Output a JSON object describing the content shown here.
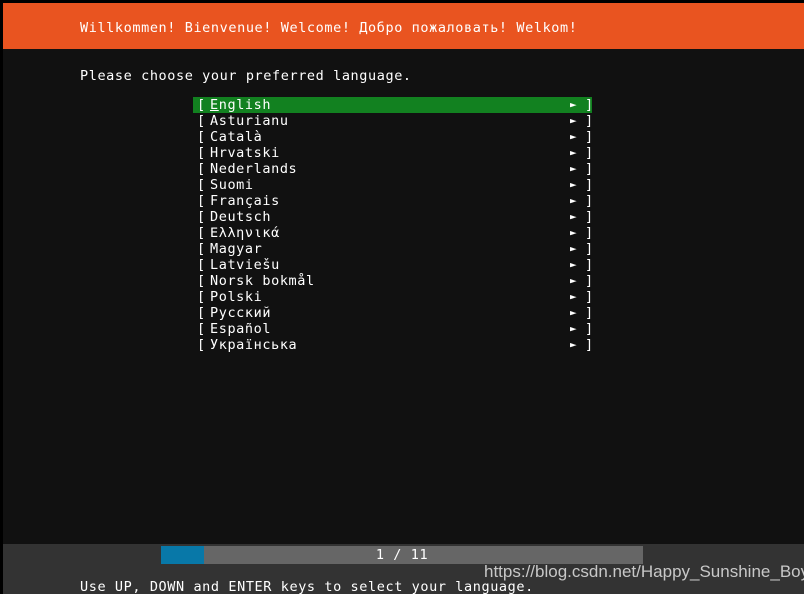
{
  "header": {
    "title": "Willkommen! Bienvenue! Welcome! Добро пожаловать! Welkom!",
    "background_color": "#e95420"
  },
  "main": {
    "prompt": "Please choose your preferred language.",
    "bracket_open": "[",
    "bracket_close": "]",
    "arrow_glyph": "►",
    "selected_index": 0,
    "selected_color": "#128120",
    "languages": [
      {
        "label": "English",
        "mnemonic": "E",
        "rest": "nglish",
        "selected": true
      },
      {
        "label": "Asturianu",
        "selected": false
      },
      {
        "label": "Català",
        "selected": false
      },
      {
        "label": "Hrvatski",
        "selected": false
      },
      {
        "label": "Nederlands",
        "selected": false
      },
      {
        "label": "Suomi",
        "selected": false
      },
      {
        "label": "Français",
        "selected": false
      },
      {
        "label": "Deutsch",
        "selected": false
      },
      {
        "label": "Ελληνικά",
        "selected": false
      },
      {
        "label": "Magyar",
        "selected": false
      },
      {
        "label": "Latviešu",
        "selected": false
      },
      {
        "label": "Norsk bokmål",
        "selected": false
      },
      {
        "label": "Polski",
        "selected": false
      },
      {
        "label": "Русский",
        "selected": false
      },
      {
        "label": "Español",
        "selected": false
      },
      {
        "label": "Українська",
        "selected": false
      }
    ]
  },
  "footer": {
    "progress": {
      "current": "1",
      "total": "11",
      "label": "1 / 11",
      "fill_color": "#0878a8",
      "track_color": "#666666",
      "percent": 9
    },
    "hint": "Use UP, DOWN and ENTER keys to select your language.",
    "watermark": "https://blog.csdn.net/Happy_Sunshine_Boy",
    "background_color": "#333333"
  }
}
